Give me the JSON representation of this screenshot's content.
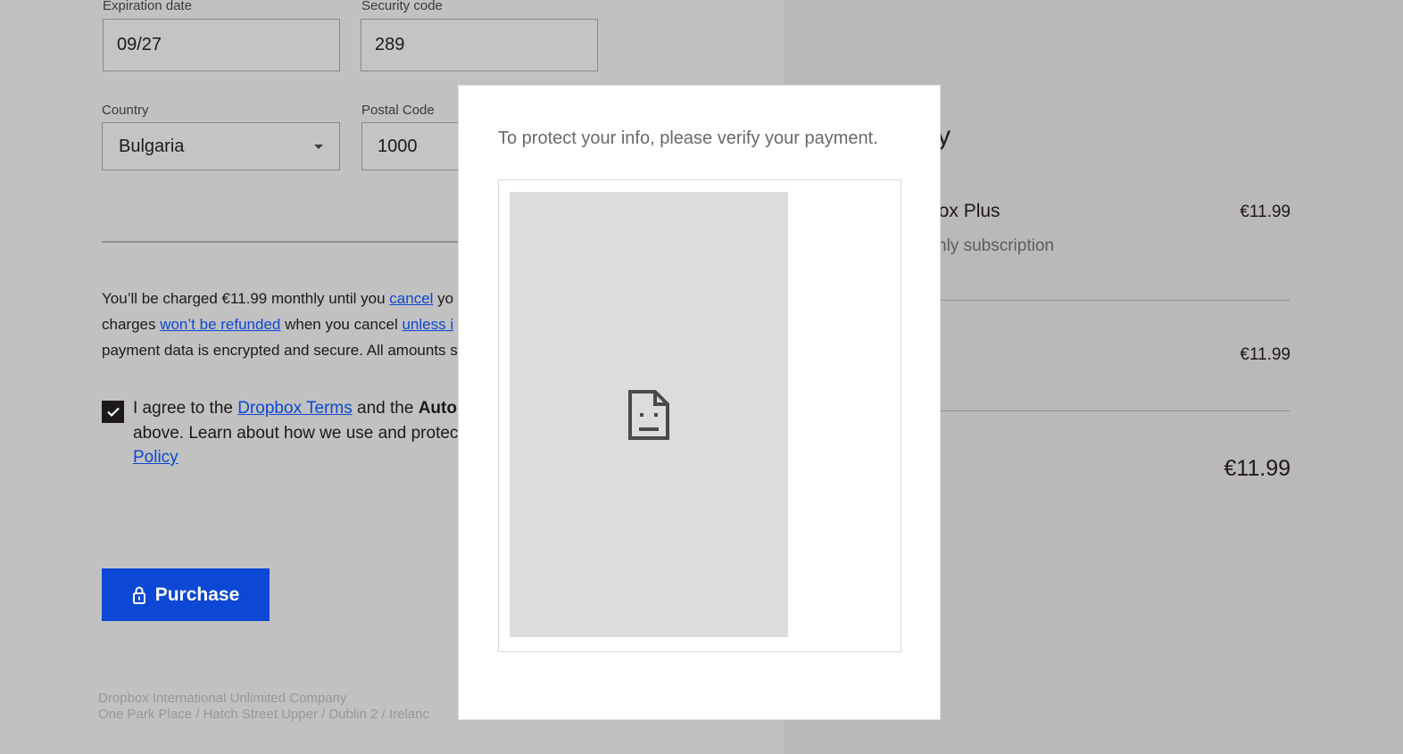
{
  "form": {
    "expiration_label": "Expiration date",
    "expiration_value": "09/27",
    "security_label": "Security code",
    "security_value": "289",
    "country_label": "Country",
    "country_value": "Bulgaria",
    "postal_label": "Postal Code",
    "postal_value": "1000"
  },
  "legal": {
    "l1a": "You’ll be charged €11.99 monthly until you ",
    "l1link": "cancel",
    "l1b": " yo",
    "l2a": "charges ",
    "l2link1": "won’t be refunded",
    "l2b": " when you cancel ",
    "l2link2": "unless i",
    "l3": "payment data is encrypted and secure. All amounts s"
  },
  "agree": {
    "a1": "I agree to the ",
    "terms_link": "Dropbox Terms",
    "a2": " and the ",
    "bold": "Autom",
    "line2": "above. Learn about how we use and protect",
    "policy_link": "Policy",
    "checked": true
  },
  "purchase_button": "Purchase",
  "footer": {
    "line1": "Dropbox International Unlimited Company",
    "line2": "One Park Place / Hatch Street Upper / Dublin 2 / Irelanc"
  },
  "summary": {
    "title_fragment": "y",
    "product": "box Plus",
    "product_price": "€11.99",
    "product_sub": "hly subscription",
    "subtotal_price": "€11.99",
    "total_price": "€11.99"
  },
  "modal": {
    "title": "To protect your info, please verify your payment."
  },
  "colors": {
    "accent": "#0d47d6",
    "overlay_left": "#c1c1c1",
    "overlay_right": "#bab9b7"
  }
}
